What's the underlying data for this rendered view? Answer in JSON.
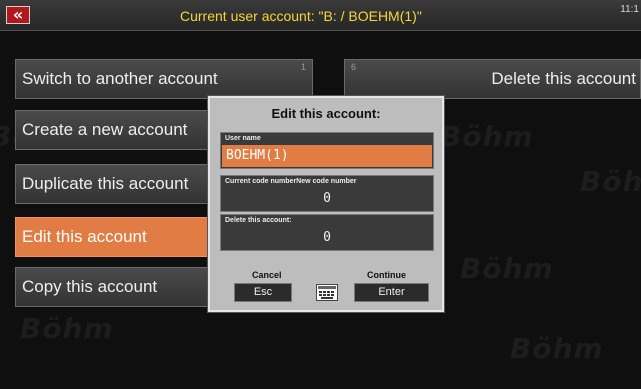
{
  "header": {
    "back_symbol": "«",
    "title": "Current user account: \"B: / BOEHM(1)\"",
    "clock": "11:1"
  },
  "watermark": {
    "text": "Böhm"
  },
  "menu": {
    "left": [
      {
        "label": "Switch to another account",
        "slot": "1"
      },
      {
        "label": "Create a new account",
        "slot": ""
      },
      {
        "label": "Duplicate this account",
        "slot": ""
      },
      {
        "label": "Edit this account",
        "slot": "",
        "selected": true
      },
      {
        "label": "Copy this account",
        "slot": ""
      }
    ],
    "right": [
      {
        "label": "Delete this account",
        "slot": "6"
      }
    ]
  },
  "dialog": {
    "title": "Edit this account:",
    "fields": [
      {
        "label": "User name",
        "value": "BOEHM(1)"
      },
      {
        "label": "Current code numberNew code number",
        "value": "0"
      },
      {
        "label": "Delete this account:",
        "value": "0"
      }
    ],
    "cancel": {
      "label": "Cancel",
      "key": "Esc"
    },
    "continue": {
      "label": "Continue",
      "key": "Enter"
    }
  }
}
